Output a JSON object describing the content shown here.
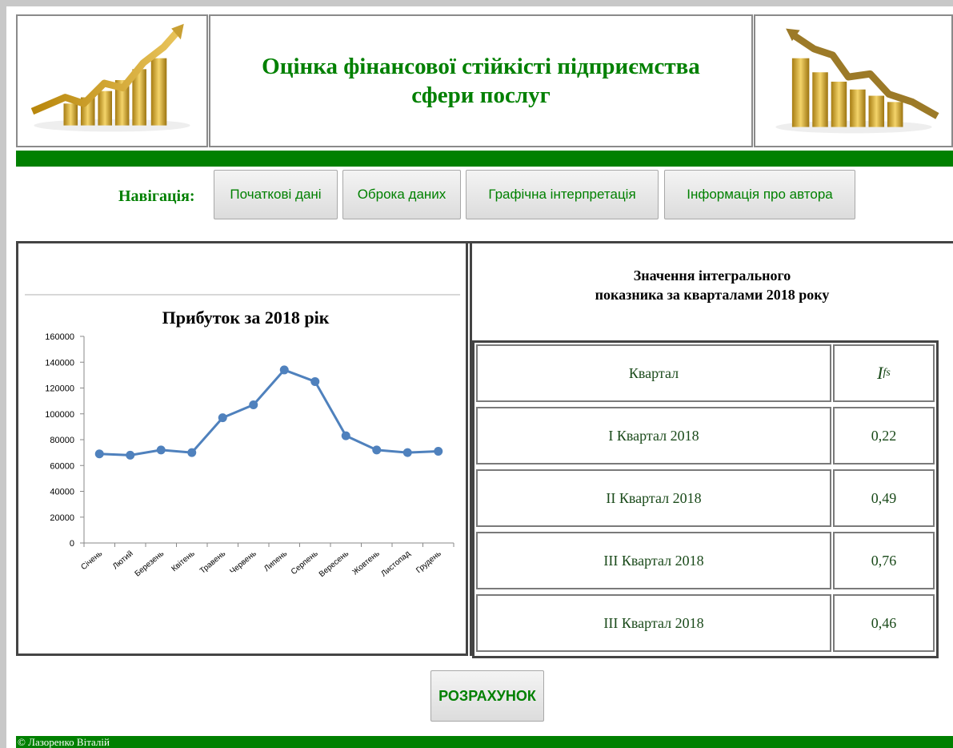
{
  "header": {
    "title_line1": "Оцінка фінансової стійкісті підприємства",
    "title_line2": "сфери послуг"
  },
  "nav": {
    "label": "Навігація:",
    "items": [
      {
        "label": "Початкові дані"
      },
      {
        "label": "Оброка даних"
      },
      {
        "label": "Графічна інтерпретація"
      },
      {
        "label": "Інформація про автора"
      }
    ]
  },
  "chart_data": {
    "type": "line",
    "title": "Прибуток за 2018 рік",
    "categories": [
      "Січень",
      "Лютий",
      "Березень",
      "Квітень",
      "Травень",
      "Червень",
      "Липень",
      "Серпень",
      "Вересень",
      "Жовтень",
      "Листопад",
      "Грудень"
    ],
    "values": [
      69000,
      68000,
      72000,
      70000,
      97000,
      107000,
      134000,
      125000,
      83000,
      72000,
      70000,
      71000
    ],
    "ylim": [
      0,
      160000
    ],
    "yticks": [
      "0",
      "20000",
      "40000",
      "60000",
      "80000",
      "100000",
      "120000",
      "140000",
      "160000"
    ],
    "series_color": "#4f81bd"
  },
  "table": {
    "heading_line1": "Значення інтегрального",
    "heading_line2": "показника за кварталами 2018 року",
    "col1_header": "Квартал",
    "col2_header_main": "I",
    "col2_header_sub": "fs",
    "rows": [
      {
        "quarter": "I Квартал 2018",
        "value": "0,22"
      },
      {
        "quarter": "II Квартал 2018",
        "value": "0,49"
      },
      {
        "quarter": "III Квартал 2018",
        "value": "0,76"
      },
      {
        "quarter": "III Квартал 2018",
        "value": "0,46"
      }
    ]
  },
  "calc_button": {
    "label": "РОЗРАХУНОК"
  },
  "footer": {
    "text": "© Лазоренко Віталій"
  },
  "colors": {
    "brand_green": "#008000",
    "series_blue": "#4f81bd"
  }
}
